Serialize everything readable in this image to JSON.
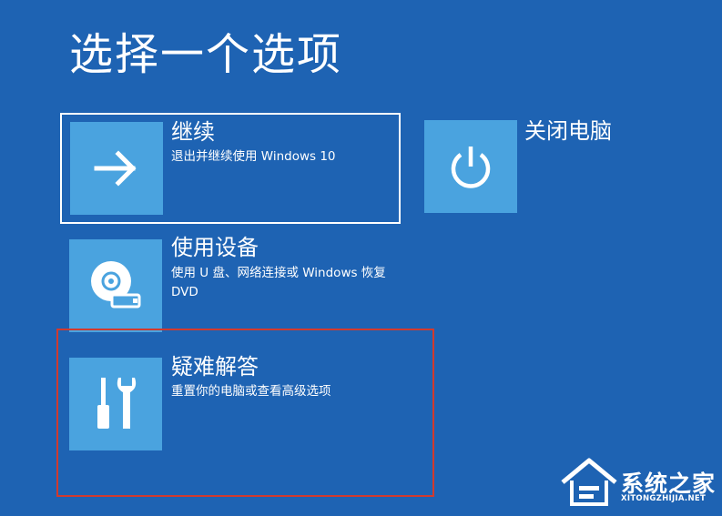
{
  "page": {
    "title": "选择一个选项"
  },
  "options": [
    {
      "title": "继续",
      "description": "退出并继续使用 Windows 10",
      "icon": "arrow-right-icon"
    },
    {
      "title": "关闭电脑",
      "description": "",
      "icon": "power-icon"
    },
    {
      "title": "使用设备",
      "description": "使用 U 盘、网络连接或 Windows 恢复 DVD",
      "icon": "disc-usb-icon"
    },
    {
      "title": "疑难解答",
      "description": "重置你的电脑或查看高级选项",
      "icon": "tools-icon"
    }
  ],
  "watermark": {
    "name": "系统之家",
    "url": "XITONGZHIJIA.NET"
  },
  "colors": {
    "background": "#1e63b3",
    "tile": "#4aa3df",
    "focus_border": "#ffffff",
    "annotation_border": "#d23a2e"
  }
}
